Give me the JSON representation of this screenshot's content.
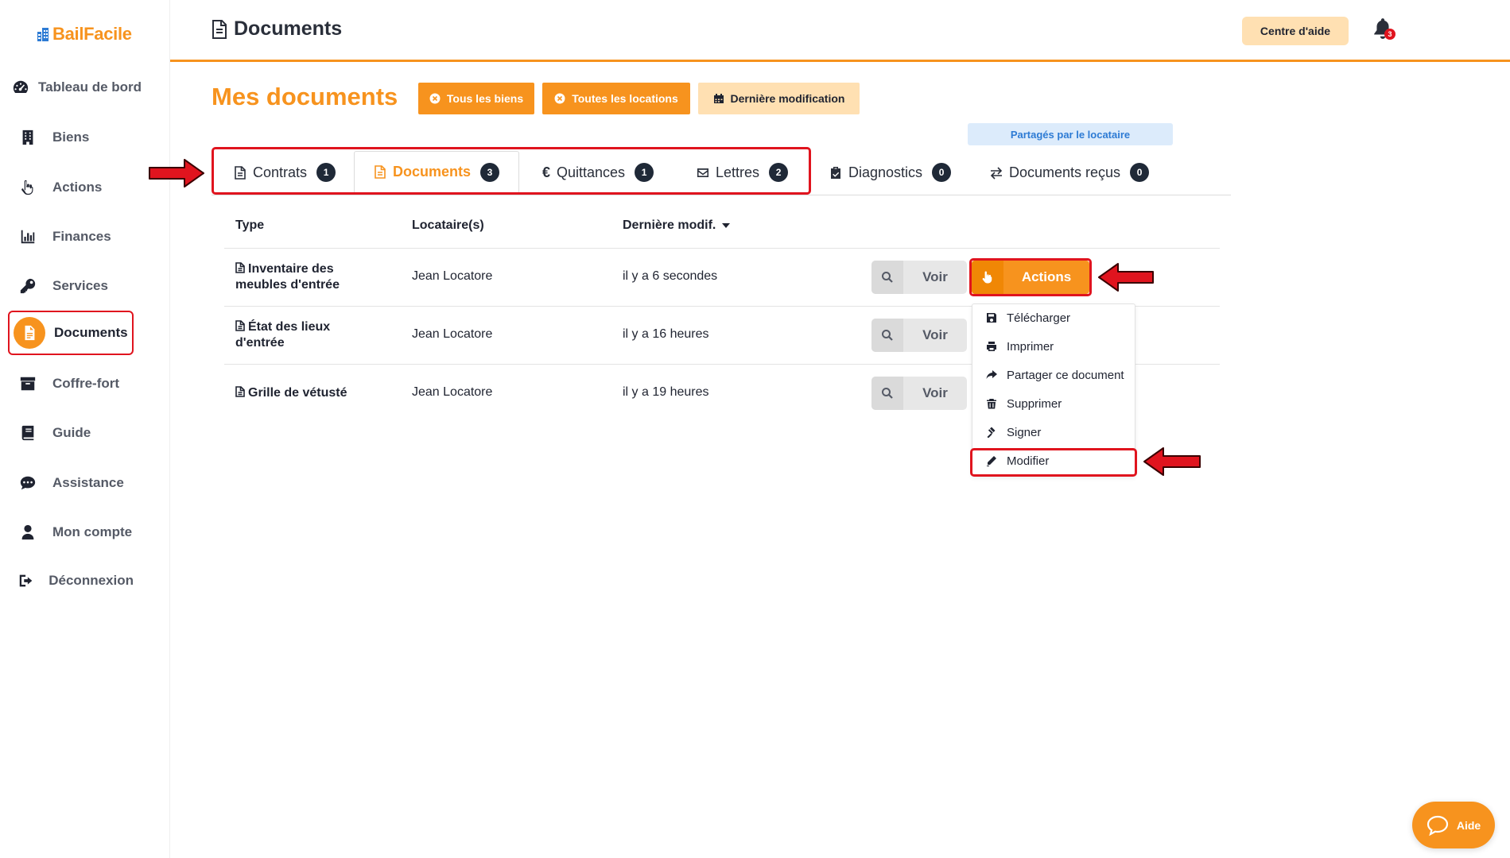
{
  "app": {
    "name": "BailFacile"
  },
  "sidebar": {
    "items": [
      {
        "label": "Tableau de bord",
        "icon": "dashboard-icon"
      },
      {
        "label": "Biens",
        "icon": "building-icon"
      },
      {
        "label": "Actions",
        "icon": "hand-pointer-icon"
      },
      {
        "label": "Finances",
        "icon": "bar-chart-icon"
      },
      {
        "label": "Services",
        "icon": "key-icon"
      },
      {
        "label": "Documents",
        "icon": "document-icon",
        "active": true
      },
      {
        "label": "Coffre-fort",
        "icon": "archive-icon"
      },
      {
        "label": "Guide",
        "icon": "book-icon"
      },
      {
        "label": "Assistance",
        "icon": "chat-icon"
      },
      {
        "label": "Mon compte",
        "icon": "user-icon"
      },
      {
        "label": "Déconnexion",
        "icon": "logout-icon"
      }
    ]
  },
  "header": {
    "title": "Documents",
    "help_label": "Centre d'aide",
    "notification_count": "3"
  },
  "main": {
    "title": "Mes documents",
    "filters": [
      {
        "label": "Tous les biens",
        "style": "orange",
        "icon": "times-circle-icon"
      },
      {
        "label": "Toutes les locations",
        "style": "orange",
        "icon": "times-circle-icon"
      },
      {
        "label": "Dernière modification",
        "style": "light",
        "icon": "calendar-icon"
      }
    ],
    "shared_label": "Partagés par le locataire",
    "tabs": [
      {
        "label": "Contrats",
        "count": "1",
        "icon": "file-icon"
      },
      {
        "label": "Documents",
        "count": "3",
        "icon": "file-icon",
        "active": true
      },
      {
        "label": "Quittances",
        "count": "1",
        "icon": "euro-icon"
      },
      {
        "label": "Lettres",
        "count": "2",
        "icon": "envelope-icon"
      },
      {
        "label": "Diagnostics",
        "count": "0",
        "icon": "clipboard-check-icon"
      },
      {
        "label": "Documents reçus",
        "count": "0",
        "icon": "exchange-icon"
      }
    ],
    "table": {
      "headers": {
        "type": "Type",
        "tenant": "Locataire(s)",
        "modified": "Dernière modif."
      },
      "rows": [
        {
          "type": "Inventaire des meubles d'entrée",
          "tenant": "Jean Locatore",
          "modified": "il y a 6 secondes"
        },
        {
          "type": "État des lieux d'entrée",
          "tenant": "Jean Locatore",
          "modified": "il y a 16 heures"
        },
        {
          "type": "Grille de vétusté",
          "tenant": "Jean Locatore",
          "modified": "il y a 19 heures"
        }
      ],
      "view_label": "Voir",
      "actions_label": "Actions"
    },
    "dropdown": [
      {
        "label": "Télécharger",
        "icon": "save-icon"
      },
      {
        "label": "Imprimer",
        "icon": "print-icon"
      },
      {
        "label": "Partager ce document",
        "icon": "share-icon"
      },
      {
        "label": "Supprimer",
        "icon": "trash-icon"
      },
      {
        "label": "Signer",
        "icon": "gavel-icon"
      },
      {
        "label": "Modifier",
        "icon": "pencil-icon"
      }
    ]
  },
  "help_widget": {
    "label": "Aide"
  },
  "colors": {
    "accent": "#f7931e",
    "light_accent": "#ffe0b2",
    "highlight": "#e0141e",
    "badge": "#1f2937"
  }
}
